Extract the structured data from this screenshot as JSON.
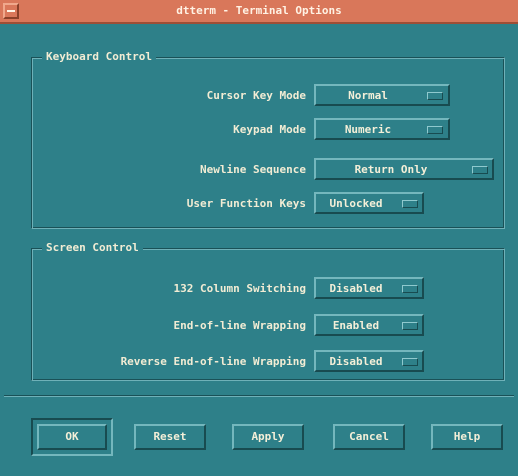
{
  "window": {
    "title": "dtterm - Terminal Options"
  },
  "keyboard": {
    "legend": "Keyboard Control",
    "rows": [
      {
        "label": "Cursor Key Mode",
        "value": "Normal"
      },
      {
        "label": "Keypad Mode",
        "value": "Numeric"
      },
      {
        "label": "Newline Sequence",
        "value": "Return Only"
      },
      {
        "label": "User Function Keys",
        "value": "Unlocked"
      }
    ]
  },
  "screen": {
    "legend": "Screen Control",
    "rows": [
      {
        "label": "132 Column Switching",
        "value": "Disabled"
      },
      {
        "label": "End-of-line Wrapping",
        "value": "Enabled"
      },
      {
        "label": "Reverse End-of-line Wrapping",
        "value": "Disabled"
      }
    ]
  },
  "buttons": {
    "ok": "OK",
    "reset": "Reset",
    "apply": "Apply",
    "cancel": "Cancel",
    "help": "Help"
  },
  "colors": {
    "background": "#2e8089",
    "titlebar": "#d9775a",
    "text": "#f2ecd4"
  },
  "icons": {
    "window_menu": "window-menu-icon",
    "option_indicator": "option-menu-indicator-icon"
  }
}
